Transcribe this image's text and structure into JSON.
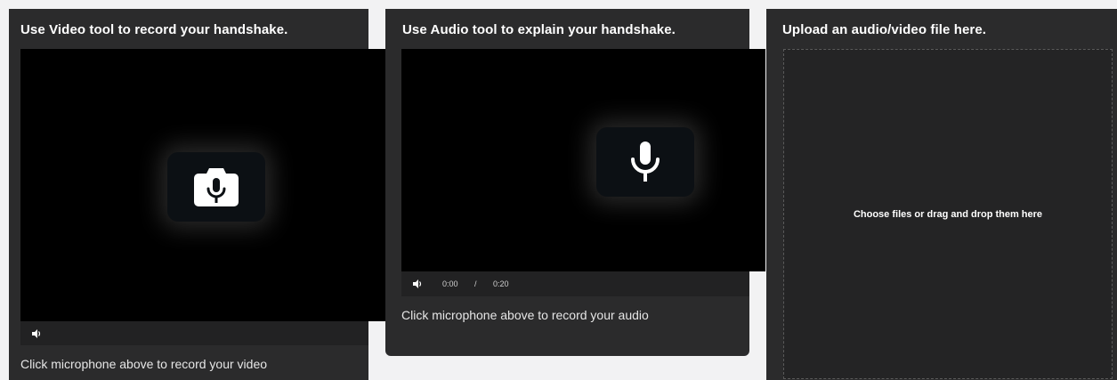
{
  "video_panel": {
    "title": "Use Video tool to record your handshake.",
    "record_icon": "camera-microphone-icon",
    "volume_icon": "speaker-icon",
    "caption": "Click microphone above to record your video"
  },
  "audio_panel": {
    "title": "Use Audio tool to explain your handshake.",
    "record_icon": "microphone-icon",
    "volume_icon": "speaker-icon",
    "current_time": "0:00",
    "time_separator": "/",
    "duration": "0:20",
    "caption": "Click microphone above to record your audio"
  },
  "upload_panel": {
    "title": "Upload an audio/video file here.",
    "dropzone_text": "Choose files or drag and drop them here"
  }
}
